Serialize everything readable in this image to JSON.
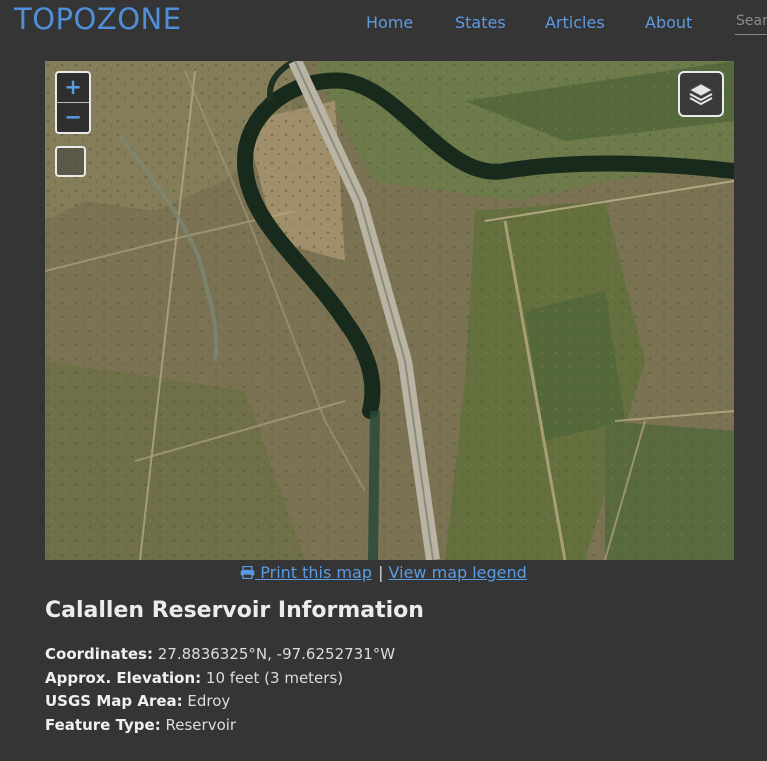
{
  "header": {
    "logo": "TOPOZONE",
    "nav": [
      {
        "label": "Home"
      },
      {
        "label": "States"
      },
      {
        "label": "Articles"
      },
      {
        "label": "About"
      }
    ],
    "search_placeholder": "Search"
  },
  "map": {
    "zoom_in": "+",
    "zoom_out": "−",
    "print_label": "Print this map",
    "separator": "|",
    "legend_label": "View map legend"
  },
  "info": {
    "title": "Calallen Reservoir Information",
    "rows": [
      {
        "label": "Coordinates:",
        "value": "27.8836325°N, -97.6252731°W"
      },
      {
        "label": "Approx. Elevation:",
        "value": "10 feet (3 meters)"
      },
      {
        "label": "USGS Map Area:",
        "value": "Edroy"
      },
      {
        "label": "Feature Type:",
        "value": "Reservoir"
      }
    ]
  },
  "colors": {
    "accent": "#5b9be4",
    "background": "#353535"
  }
}
